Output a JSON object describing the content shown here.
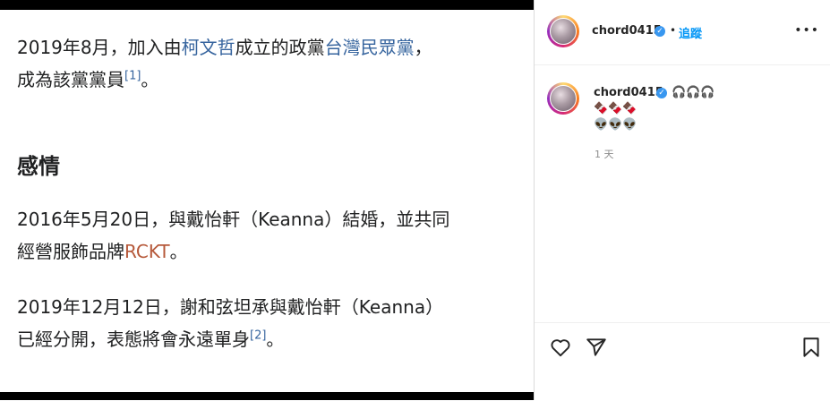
{
  "article": {
    "p1": {
      "line1_a": "2019年8月，加入由",
      "line1_link1": "柯文哲",
      "line1_b": "成立的政黨",
      "line1_link2": "台灣民眾黨",
      "line1_c": "，",
      "line2_a": "成為該黨黨員",
      "line2_ref": "[1]",
      "line2_b": "。"
    },
    "heading": "感情",
    "p2": {
      "line1": "2016年5月20日，與戴怡軒（Keanna）結婚，並共同",
      "line2_a": "經營服飾品牌",
      "line2_link": "RCKT",
      "line2_b": "。"
    },
    "p3": {
      "line1": "2019年12月12日，謝和弦坦承與戴怡軒（Keanna）",
      "line2_a": "已經分開，表態將會永遠單身",
      "line2_ref": "[2]",
      "line2_b": "。"
    }
  },
  "post": {
    "username": "chord0415",
    "verified_mark": "✓",
    "separator": "•",
    "follow_label": "追蹤",
    "more_label": "•••",
    "comment": {
      "username": "chord0415",
      "line1_emoji": "🎧🎧🎧",
      "line2_emoji": "🍫🍫🍫",
      "line3_emoji": "👽👽👽",
      "time": "1 天"
    }
  },
  "icons": {
    "like": "heart-icon",
    "share": "paper-plane-icon",
    "save": "bookmark-icon"
  }
}
